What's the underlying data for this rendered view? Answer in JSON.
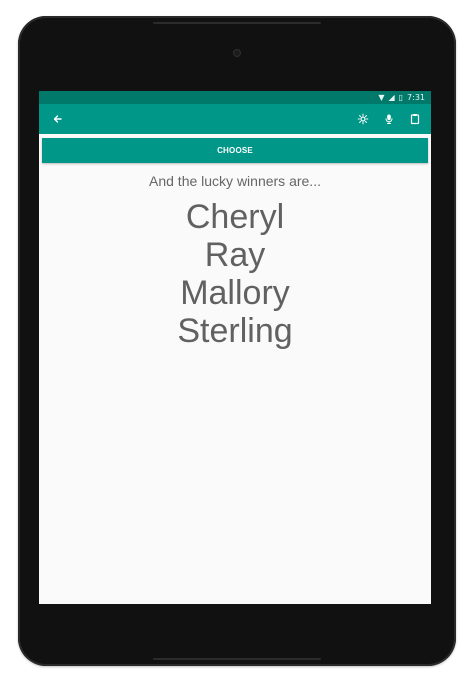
{
  "status_bar": {
    "time": "7:31",
    "wifi_icon": "wifi-icon",
    "signal_icon": "signal-icon",
    "battery_icon": "battery-icon"
  },
  "toolbar": {
    "back_icon": "back-arrow-icon",
    "settings_icon": "gear-icon",
    "microphone_icon": "microphone-icon",
    "clipboard_icon": "clipboard-icon"
  },
  "actions": {
    "choose_label": "CHOOSE"
  },
  "main": {
    "subtitle": "And the lucky winners are...",
    "winners": [
      "Cheryl",
      "Ray",
      "Mallory",
      "Sterling"
    ]
  },
  "colors": {
    "status_bar": "#00796b",
    "toolbar": "#009688",
    "screen_background": "#fafafa",
    "text": "#616161"
  }
}
